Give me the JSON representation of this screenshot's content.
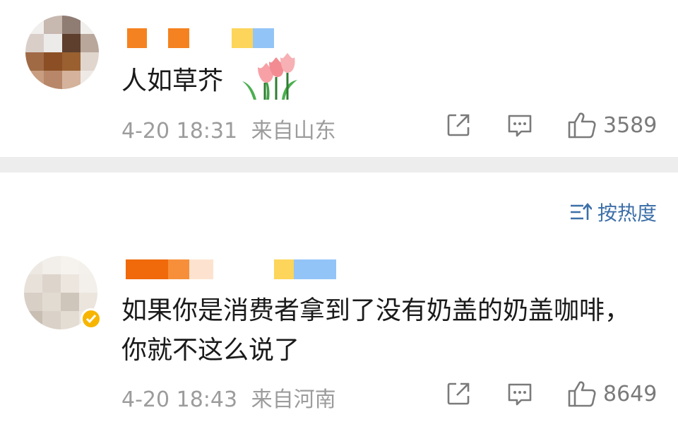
{
  "comments": [
    {
      "text_lines": [
        "人如草芥"
      ],
      "emoji": "tulip-emoji",
      "time": "4-20 18:31",
      "location": "来自山东",
      "likes": "3589",
      "verified": false
    },
    {
      "text_lines": [
        "如果你是消费者拿到了没有奶盖的奶盖咖啡，",
        "你就不这么说了"
      ],
      "time": "4-20 18:43",
      "location": "来自河南",
      "likes": "8649",
      "verified": true
    }
  ],
  "sort": {
    "label": "按热度",
    "icon": "sort-icon"
  },
  "colors": {
    "text": "#1a1a1a",
    "meta": "#9c9c9c",
    "icon": "#7a7a7a",
    "divider": "#ededed",
    "sort": "#3d6fa8",
    "name_orange": "#f58220",
    "name_yellow": "#fcd55a",
    "name_blue": "#93c4f7",
    "verified_badge": "#f7b500"
  }
}
